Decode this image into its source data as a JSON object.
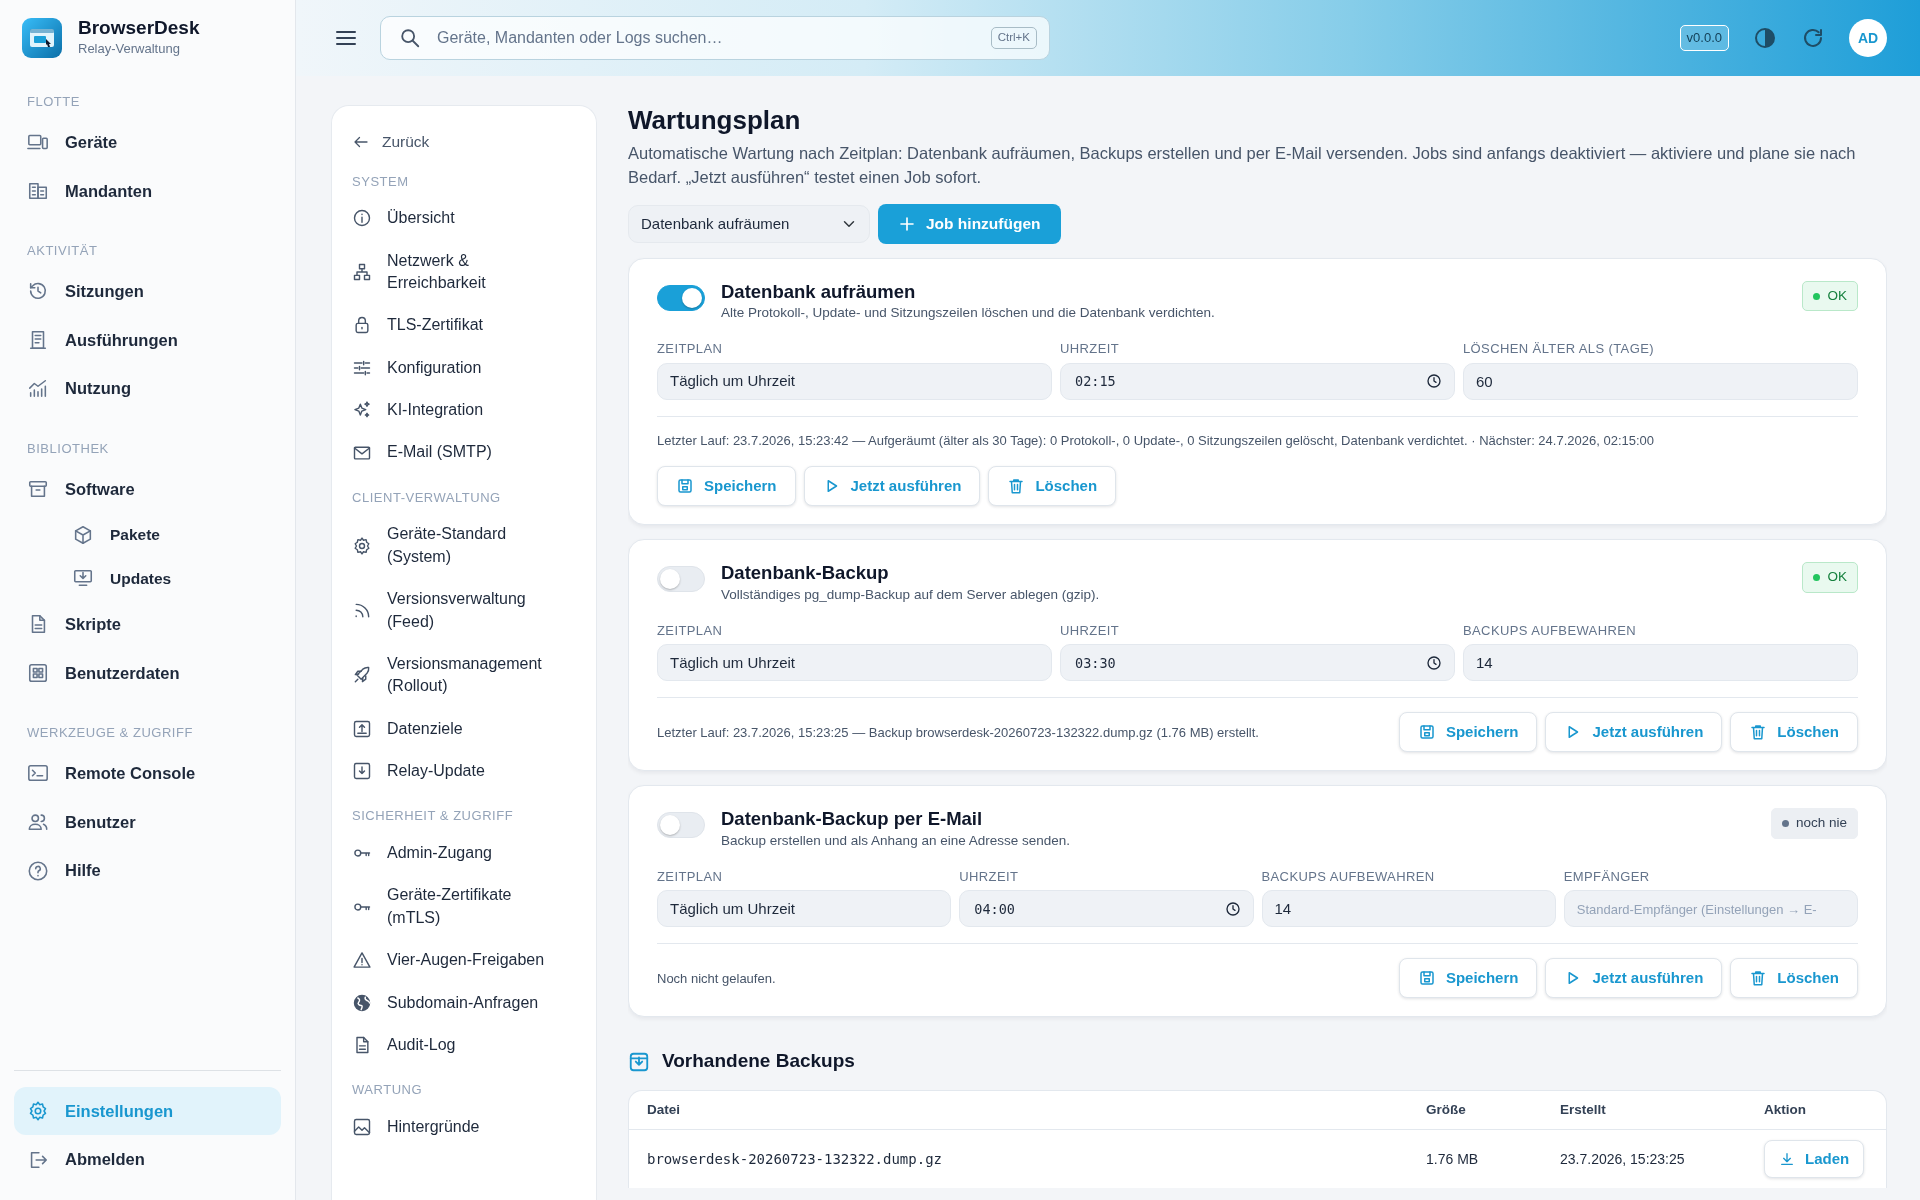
{
  "brand": {
    "name": "BrowserDesk",
    "subtitle": "Relay-Verwaltung"
  },
  "sidebar": {
    "sections": [
      {
        "title": "FLOTTE",
        "items": [
          {
            "label": "Geräte"
          },
          {
            "label": "Mandanten"
          }
        ]
      },
      {
        "title": "AKTIVITÄT",
        "items": [
          {
            "label": "Sitzungen"
          },
          {
            "label": "Ausführungen"
          },
          {
            "label": "Nutzung"
          }
        ]
      },
      {
        "title": "BIBLIOTHEK",
        "items": [
          {
            "label": "Software",
            "children": [
              {
                "label": "Pakete"
              },
              {
                "label": "Updates"
              }
            ]
          },
          {
            "label": "Skripte"
          },
          {
            "label": "Benutzerdaten"
          }
        ]
      },
      {
        "title": "WERKZEUGE & ZUGRIFF",
        "items": [
          {
            "label": "Remote Console"
          },
          {
            "label": "Benutzer"
          },
          {
            "label": "Hilfe"
          }
        ]
      }
    ],
    "footer_items": [
      {
        "label": "Einstellungen",
        "selected": true
      },
      {
        "label": "Abmelden",
        "selected": false
      }
    ]
  },
  "header": {
    "search": {
      "placeholder": "Geräte, Mandanten oder Logs suchen…",
      "shortcut": "Ctrl+K"
    },
    "version": "v0.0.0",
    "avatar": "AD"
  },
  "settings_nav": {
    "back": "Zurück",
    "sections": [
      {
        "title": "SYSTEM",
        "items": [
          {
            "label": "Übersicht"
          },
          {
            "label": "Netzwerk & Erreichbarkeit"
          },
          {
            "label": "TLS-Zertifikat"
          },
          {
            "label": "Konfiguration"
          },
          {
            "label": "KI-Integration"
          },
          {
            "label": "E-Mail (SMTP)"
          }
        ]
      },
      {
        "title": "CLIENT-VERWALTUNG",
        "items": [
          {
            "label": "Geräte-Standard (System)"
          },
          {
            "label": "Versionsverwaltung (Feed)"
          },
          {
            "label": "Versionsmanagement (Rollout)"
          },
          {
            "label": "Datenziele"
          },
          {
            "label": "Relay-Update"
          }
        ]
      },
      {
        "title": "SICHERHEIT & ZUGRIFF",
        "items": [
          {
            "label": "Admin-Zugang"
          },
          {
            "label": "Geräte-Zertifikate (mTLS)"
          },
          {
            "label": "Vier-Augen-Freigaben"
          },
          {
            "label": "Subdomain-Anfragen"
          },
          {
            "label": "Audit-Log"
          }
        ]
      },
      {
        "title": "WARTUNG",
        "items": [
          {
            "label": "Hintergründe"
          }
        ]
      }
    ]
  },
  "page": {
    "title": "Wartungsplan",
    "description": "Automatische Wartung nach Zeitplan: Datenbank aufräumen, Backups erstellen und per E-Mail versenden. Jobs sind anfangs deaktiviert — aktiviere und plane sie nach Bedarf. „Jetzt ausführen“ testet einen Job sofort.",
    "job_select": "Datenbank aufräumen",
    "add_button": "Job hinzufügen"
  },
  "jobs": [
    {
      "title": "Datenbank aufräumen",
      "description": "Alte Protokoll-, Update- und Sitzungszeilen löschen und die Datenbank verdichten.",
      "on": true,
      "status": {
        "label": "OK",
        "kind": "ok"
      },
      "fields": [
        {
          "label": "ZEITPLAN",
          "kind": "select",
          "value": "Täglich um Uhrzeit"
        },
        {
          "label": "UHRZEIT",
          "kind": "time",
          "value": "02:15"
        },
        {
          "label": "LÖSCHEN ÄLTER ALS (TAGE)",
          "kind": "text",
          "value": "60"
        }
      ],
      "last_run": "Letzter Lauf: 23.7.2026, 15:23:42 — Aufgeräumt (älter als 30 Tage): 0 Protokoll-, 0 Update-, 0 Sitzungszeilen gelöscht, Datenbank verdichtet. · Nächster: 24.7.2026, 02:15:00",
      "buttons": [
        {
          "label": "Speichern",
          "kind": "save"
        },
        {
          "label": "Jetzt ausführen",
          "kind": "run"
        },
        {
          "label": "Löschen",
          "kind": "delete"
        }
      ]
    },
    {
      "title": "Datenbank-Backup",
      "description": "Vollständiges pg_dump-Backup auf dem Server ablegen (gzip).",
      "on": false,
      "status": {
        "label": "OK",
        "kind": "ok"
      },
      "fields": [
        {
          "label": "ZEITPLAN",
          "kind": "select",
          "value": "Täglich um Uhrzeit"
        },
        {
          "label": "UHRZEIT",
          "kind": "time",
          "value": "03:30"
        },
        {
          "label": "BACKUPS AUFBEWAHREN",
          "kind": "text",
          "value": "14"
        }
      ],
      "last_run": "Letzter Lauf: 23.7.2026, 15:23:25 — Backup browserdesk-20260723-132322.dump.gz (1.76 MB) erstellt.",
      "buttons": [
        {
          "label": "Speichern",
          "kind": "save"
        },
        {
          "label": "Jetzt ausführen",
          "kind": "run"
        },
        {
          "label": "Löschen",
          "kind": "delete"
        }
      ]
    },
    {
      "title": "Datenbank-Backup per E-Mail",
      "description": "Backup erstellen und als Anhang an eine Adresse senden.",
      "on": false,
      "status": {
        "label": "noch nie",
        "kind": "never"
      },
      "fields": [
        {
          "label": "ZEITPLAN",
          "kind": "select",
          "value": "Täglich um Uhrzeit"
        },
        {
          "label": "UHRZEIT",
          "kind": "time",
          "value": "04:00"
        },
        {
          "label": "BACKUPS AUFBEWAHREN",
          "kind": "text",
          "value": "14"
        },
        {
          "label": "EMPFÄNGER",
          "kind": "text",
          "placeholder": "Standard-Empfänger (Einstellungen → E-"
        }
      ],
      "last_run": "Noch nicht gelaufen.",
      "buttons": [
        {
          "label": "Speichern",
          "kind": "save"
        },
        {
          "label": "Jetzt ausführen",
          "kind": "run"
        },
        {
          "label": "Löschen",
          "kind": "delete"
        }
      ]
    }
  ],
  "backups": {
    "title": "Vorhandene Backups",
    "columns": [
      "Datei",
      "Größe",
      "Erstellt",
      "Aktion"
    ],
    "rows": [
      {
        "cells": [
          "browserdesk-20260723-132322.dump.gz",
          "1.76 MB",
          "23.7.2026, 15:23:25"
        ],
        "action": "Laden"
      }
    ]
  }
}
